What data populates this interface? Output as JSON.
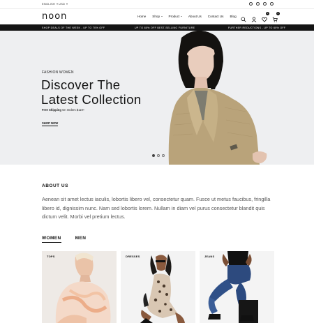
{
  "topbar": {
    "language": "ENGLISH",
    "currency": "USD"
  },
  "header": {
    "logo": "noon",
    "nav": [
      {
        "label": "Home",
        "dropdown": false
      },
      {
        "label": "Shop",
        "dropdown": true
      },
      {
        "label": "Product",
        "dropdown": true
      },
      {
        "label": "About Us",
        "dropdown": false
      },
      {
        "label": "Contact Us",
        "dropdown": false
      },
      {
        "label": "Blog",
        "dropdown": false
      }
    ],
    "wishlist_count": "0",
    "cart_count": "0"
  },
  "promo": {
    "left": "SHOP DEALS OF THE WEEK - UP TO 70% OFF",
    "center": "UP TO 80% OFF BEST-SELLING FURNITURE",
    "right": "FURTHER REDUCTIONS - UP TO 60% OFF"
  },
  "hero": {
    "eyebrow": "FASHION WOMEN",
    "title_line1": "Discover The",
    "title_line2": "Latest Collection",
    "shipping_bold": "Free Shipping",
    "shipping_rest": " On Orders $119+",
    "cta": "SHOP NOW"
  },
  "about": {
    "title": "ABOUT US",
    "text": "Aenean sit amet lectus iaculis, lobortis libero vel, consectetur quam. Fusce ut metus faucibus, fringilla libero id, dignissim nunc. Nam sed lobortis lorem. Nullam in diam vel purus consectetur blandit quis dictum velit. Morbi vel pretium lectus."
  },
  "tabs": [
    "WOMEN",
    "MEN"
  ],
  "categories": [
    {
      "label": "TOPS"
    },
    {
      "label": "DRESSES"
    },
    {
      "label": "JEANS"
    }
  ],
  "colors": {
    "promo_bg": "#141414",
    "hero_bg": "#eeeff1",
    "accent": "#111111"
  }
}
